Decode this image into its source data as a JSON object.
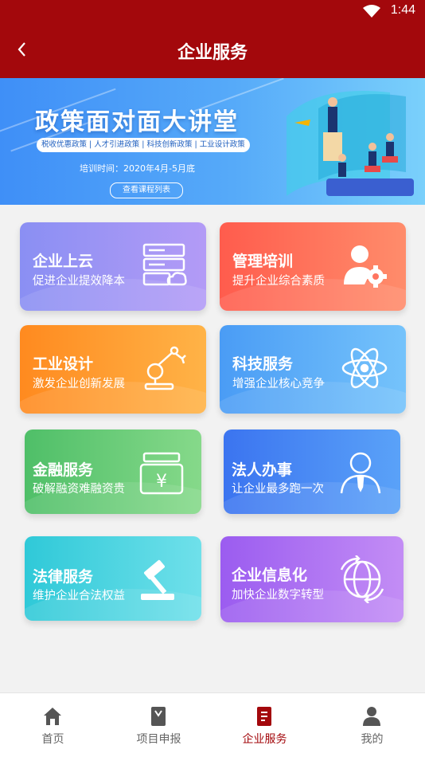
{
  "status_bar": {
    "time": "1:44"
  },
  "header": {
    "title": "企业服务"
  },
  "banner": {
    "title": "政策面对面大讲堂",
    "tags": "税收优惠政策 | 人才引进政策 | 科技创新政策 | 工业设计政策",
    "date": "培训时间：2020年4月-5月底",
    "button": "查看课程列表"
  },
  "services": [
    {
      "title": "企业上云",
      "subtitle": "促进企业提效降本",
      "colors": [
        "#8a8ff3",
        "#b39bf6"
      ],
      "icon": "server-cloud-icon"
    },
    {
      "title": "管理培训",
      "subtitle": "提升企业综合素质",
      "colors": [
        "#ff5c4d",
        "#ff8c6b"
      ],
      "icon": "user-gear-icon"
    },
    {
      "title": "工业设计",
      "subtitle": "激发企业创新发展",
      "colors": [
        "#ff8a1f",
        "#ffb347"
      ],
      "icon": "robot-arm-icon"
    },
    {
      "title": "科技服务",
      "subtitle": "增强企业核心竞争",
      "colors": [
        "#4a9cf5",
        "#75c3fb"
      ],
      "icon": "atom-icon"
    },
    {
      "title": "金融服务",
      "subtitle": "破解融资难融资贵",
      "colors": [
        "#4fbf68",
        "#86d98a"
      ],
      "icon": "money-bag-icon"
    },
    {
      "title": "法人办事",
      "subtitle": "让企业最多跑一次",
      "colors": [
        "#3b74f0",
        "#5aa2f8"
      ],
      "icon": "person-tie-icon"
    },
    {
      "title": "法律服务",
      "subtitle": "维护企业合法权益",
      "colors": [
        "#2fc9d8",
        "#6fe0ea"
      ],
      "icon": "gavel-icon"
    },
    {
      "title": "企业信息化",
      "subtitle": "加快企业数字转型",
      "colors": [
        "#9b5cf0",
        "#c38df5"
      ],
      "icon": "globe-arrows-icon"
    }
  ],
  "tabbar": {
    "tabs": [
      {
        "label": "首页",
        "icon": "home-icon"
      },
      {
        "label": "项目申报",
        "icon": "bookmark-icon"
      },
      {
        "label": "企业服务",
        "icon": "document-icon",
        "active": true
      },
      {
        "label": "我的",
        "icon": "user-icon"
      }
    ],
    "active_color": "#a3080c"
  }
}
